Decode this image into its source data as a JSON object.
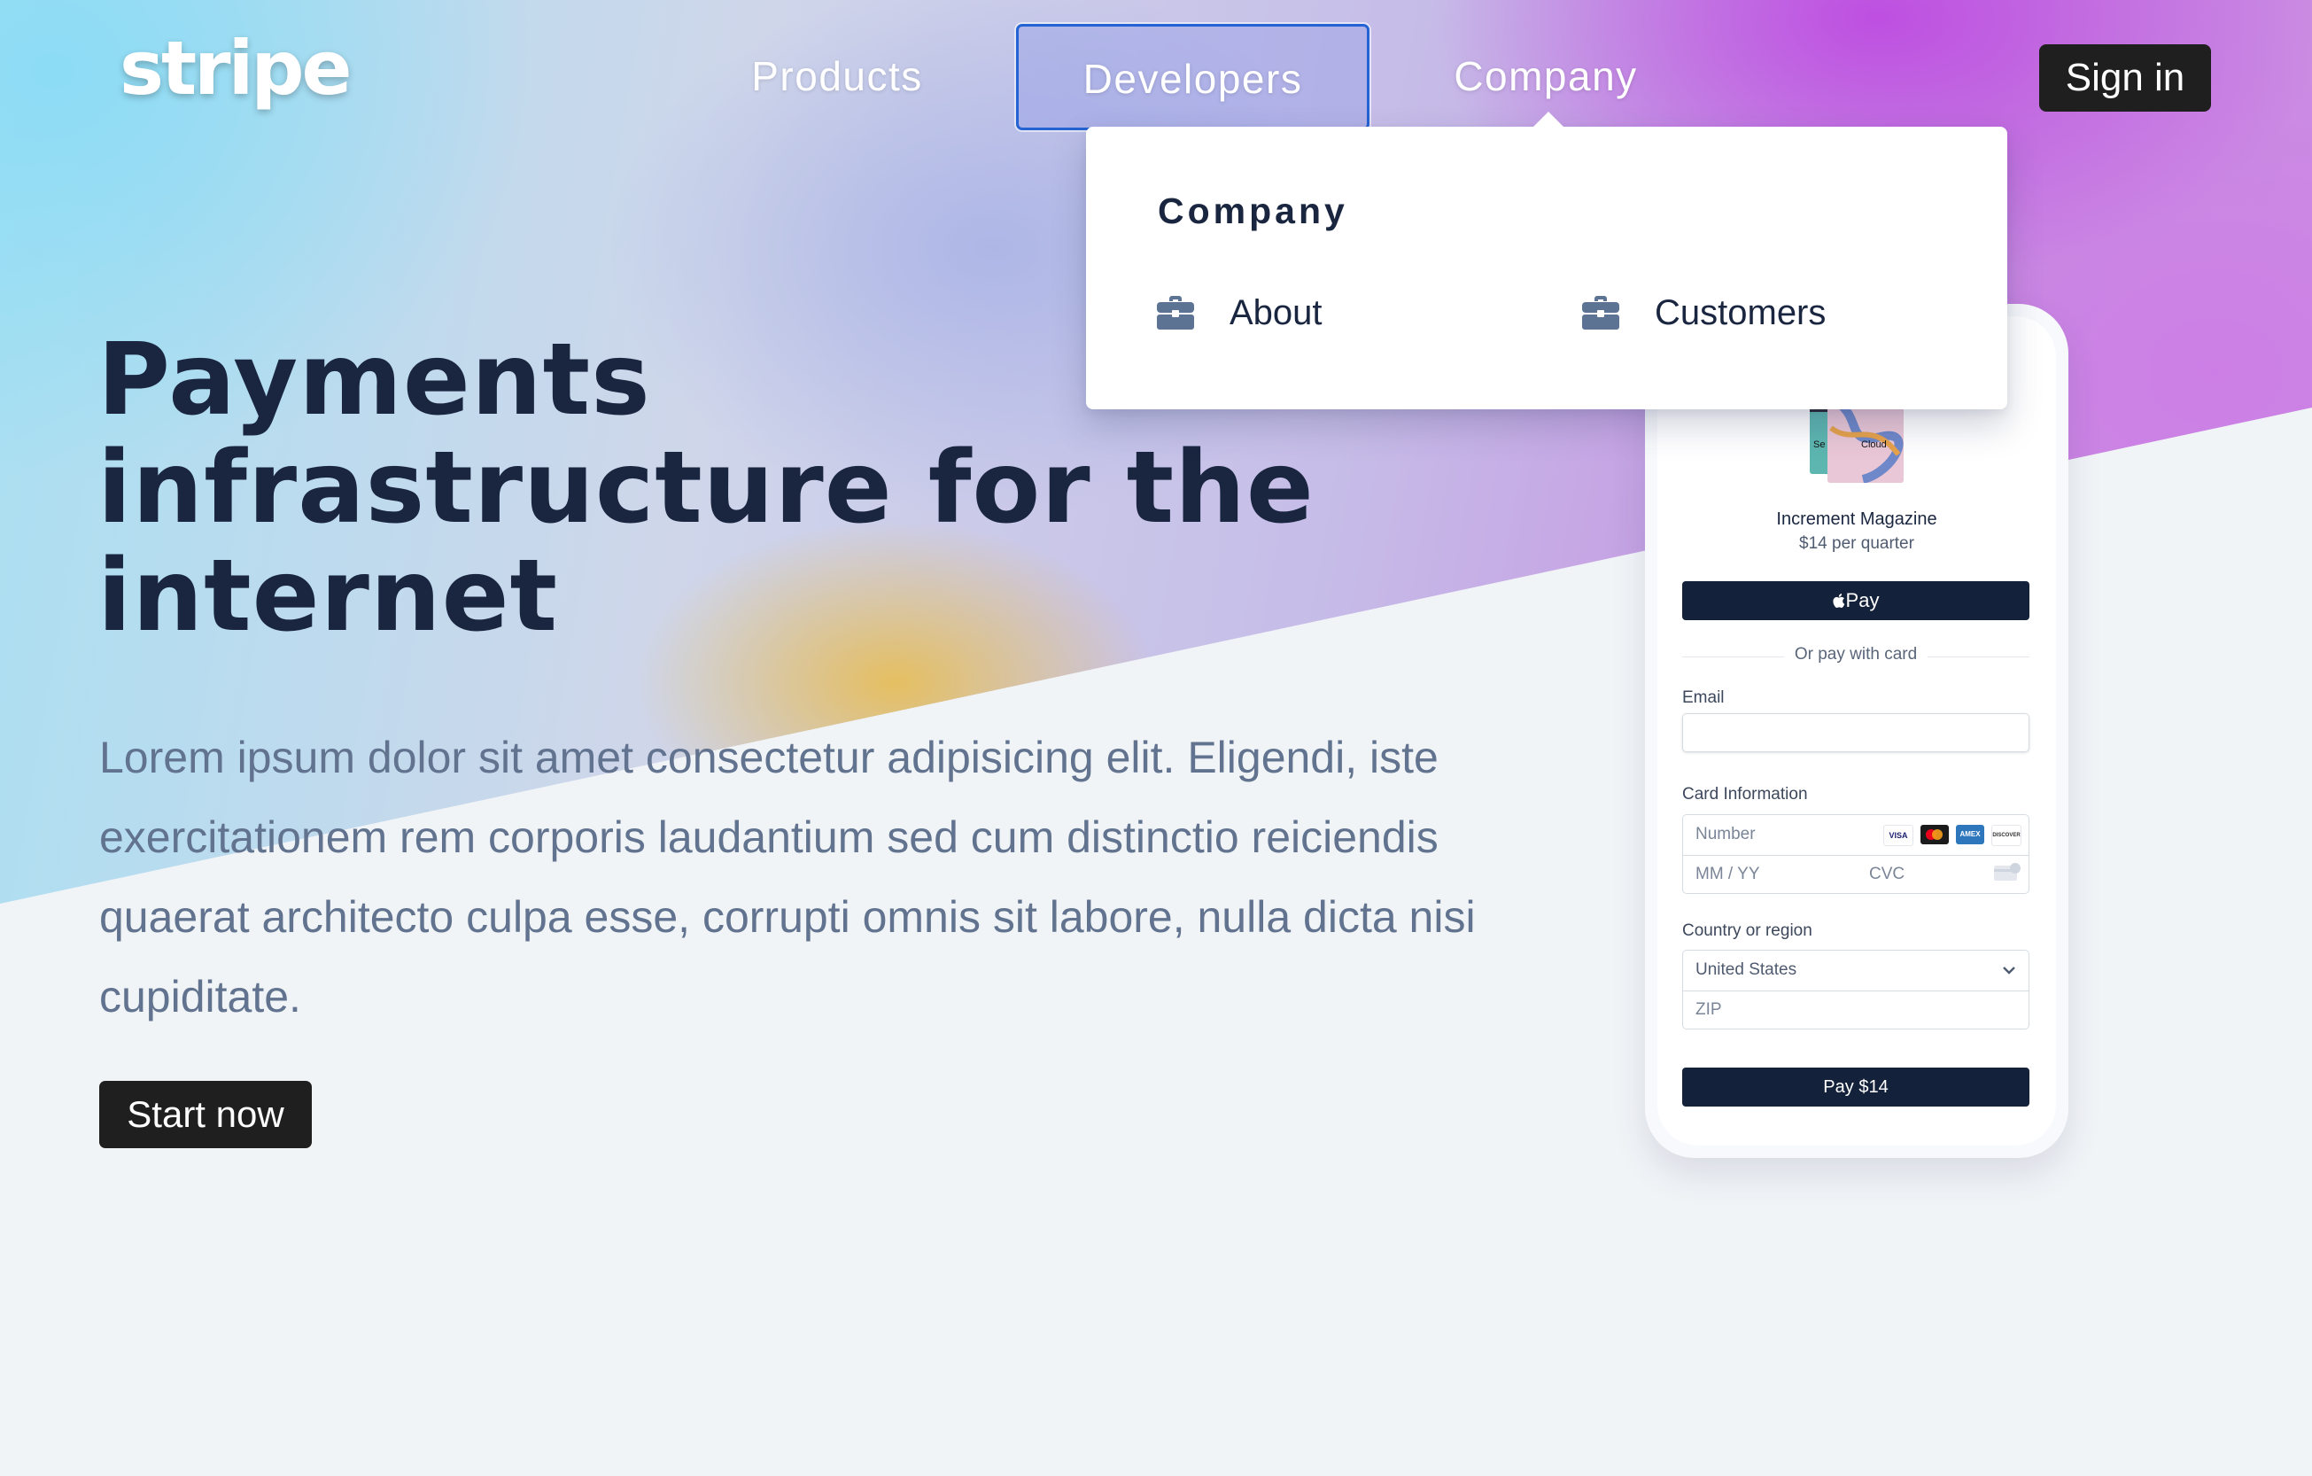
{
  "nav": {
    "logo": "stripe",
    "links": [
      "Products",
      "Developers",
      "Company"
    ],
    "sign_in": "Sign in"
  },
  "dropdown": {
    "title": "Company",
    "items": [
      {
        "label": "About",
        "icon": "briefcase-icon"
      },
      {
        "label": "Customers",
        "icon": "briefcase-icon"
      }
    ]
  },
  "hero": {
    "headline": "Payments infrastructure for the internet",
    "lead": "Lorem ipsum dolor sit amet consectetur adipisicing elit. Eligendi, iste exercitationem rem corporis laudantium sed cum distinctio reiciendis quaerat architecto culpa esse, corrupti omnis sit labore, nulla dicta nisi cupiditate.",
    "cta": "Start now"
  },
  "checkout": {
    "image_labels": [
      "Se",
      "Cloud"
    ],
    "product_title": "Increment Magazine",
    "price": "$14 per quarter",
    "apple_pay": "Pay",
    "or_pay": "Or pay with card",
    "email_label": "Email",
    "email_value": "",
    "card_label": "Card Information",
    "card_number_placeholder": "Number",
    "expiry_placeholder": "MM / YY",
    "cvc_placeholder": "CVC",
    "card_brands": [
      "VISA",
      "mastercard",
      "AMEX",
      "DISCOVER"
    ],
    "country_label": "Country or region",
    "country_value": "United States",
    "zip_placeholder": "ZIP",
    "pay_button": "Pay $14"
  },
  "colors": {
    "navy": "#1a2640",
    "button_dark": "#1f1f1f",
    "focus_ring": "#2463d3",
    "pay_navy": "#14213a",
    "body_text": "#61738f"
  }
}
